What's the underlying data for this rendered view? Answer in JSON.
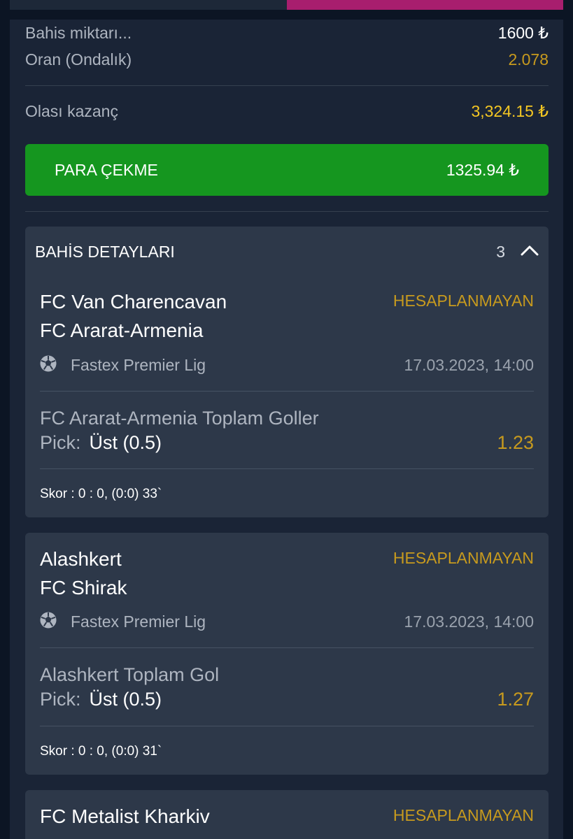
{
  "summary": {
    "stake_label": "Bahis miktarı...",
    "stake_value": "1600 ₺",
    "odds_label": "Oran (Ondalık)",
    "odds_value": "2.078",
    "potential_label": "Olası kazanç",
    "potential_value": "3,324.15 ₺"
  },
  "cashout": {
    "label": "PARA ÇEKME",
    "amount": "1325.94 ₺"
  },
  "details": {
    "title": "BAHİS DETAYLARI",
    "count": "3"
  },
  "events": [
    {
      "home": "FC Van Charencavan",
      "away": "FC Ararat-Armenia",
      "status": "HESAPLANMAYAN",
      "league": "Fastex Premier Lig",
      "datetime": "17.03.2023, 14:00",
      "market": "FC Ararat-Armenia Toplam Goller",
      "pick_label": "Pick:",
      "pick": "Üst (0.5)",
      "odd": "1.23",
      "score": "Skor : 0 : 0, (0:0) 33`"
    },
    {
      "home": "Alashkert",
      "away": "FC Shirak",
      "status": "HESAPLANMAYAN",
      "league": "Fastex Premier Lig",
      "datetime": "17.03.2023, 14:00",
      "market": "Alashkert Toplam Gol",
      "pick_label": "Pick:",
      "pick": "Üst (0.5)",
      "odd": "1.27",
      "score": "Skor : 0 : 0, (0:0) 31`"
    },
    {
      "home": "FC Metalist Kharkiv",
      "status": "HESAPLANMAYAN"
    }
  ],
  "icons": {
    "ball": "soccer-ball-icon",
    "collapse": "chevron-up-icon"
  },
  "colors": {
    "background": "#0c1524",
    "panel": "#1a2436",
    "card": "#2d3849",
    "cashout_green": "#15961f",
    "accent_gold": "#c79a1e",
    "accent_yellow": "#f3c623",
    "tab_active": "#a81e6e"
  }
}
